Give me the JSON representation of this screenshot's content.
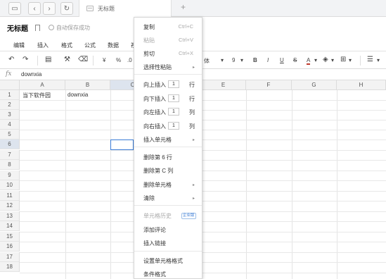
{
  "tab": {
    "title": "无标题"
  },
  "doc": {
    "title": "无标题",
    "autosave": "自动保存成功"
  },
  "menu": [
    "编辑",
    "插入",
    "格式",
    "公式",
    "数据",
    "视"
  ],
  "toolbar": {
    "currency": "¥",
    "percent": "%",
    "decimal": ".0",
    "font_name": "体",
    "font_size": "9",
    "bold": "B",
    "italic": "I",
    "underline": "U",
    "strike": "S",
    "color_a": "A"
  },
  "formula": {
    "fx": "fx",
    "value": "downxia"
  },
  "columns": [
    "A",
    "B",
    "C",
    "D",
    "E",
    "F",
    "G",
    "H"
  ],
  "rows": [
    "1",
    "2",
    "3",
    "4",
    "5",
    "6",
    "7",
    "8",
    "9",
    "10",
    "11",
    "12",
    "13",
    "14",
    "15",
    "16",
    "17",
    "18"
  ],
  "cells": {
    "A1": "当下软件园",
    "B1": "downxia"
  },
  "context_menu": {
    "copy": "复制",
    "copy_sc": "Ctrl+C",
    "paste": "粘贴",
    "paste_sc": "Ctrl+V",
    "cut": "剪切",
    "cut_sc": "Ctrl+X",
    "paste_special": "选择性粘贴",
    "insert_up": "向上插入",
    "insert_down": "向下插入",
    "insert_left": "向左插入",
    "insert_right": "向右插入",
    "count": "1",
    "unit_row": "行",
    "unit_col": "列",
    "insert_cell": "插入单元格",
    "delete_row": "删除第 6 行",
    "delete_col": "删除第 C 列",
    "delete_cell": "删除单元格",
    "clear": "清除",
    "cell_history": "单元格历史",
    "cell_history_badge": "企业版",
    "add_comment": "添加评论",
    "insert_link": "插入链接",
    "format_cells": "设置单元格格式",
    "conditional_format": "条件格式"
  }
}
